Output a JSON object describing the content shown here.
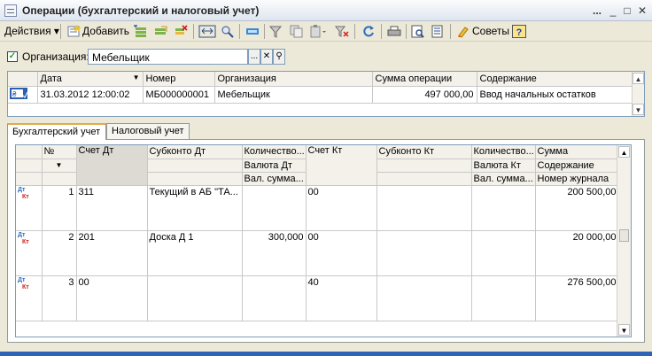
{
  "window": {
    "title": "Операции (бухгалтерский и налоговый учет)",
    "btn_more": "...",
    "btn_min": "_",
    "btn_max": "□",
    "btn_close": "✕"
  },
  "toolbar": {
    "actions_label": "Действия ▾",
    "add_label": "Добавить",
    "tips_label": "Советы"
  },
  "filter": {
    "checkbox_mark": "✓",
    "label": "Организация:",
    "value": "Мебельщик",
    "btn_select": "...",
    "btn_clear": "✕",
    "btn_open": "⚲"
  },
  "operations": {
    "columns": [
      "Дата",
      "Номер",
      "Организация",
      "Сумма операции",
      "Содержание"
    ],
    "rows": [
      {
        "date": "31.03.2012 12:00:02",
        "number": "МБ000000001",
        "org": "Мебельщик",
        "sum": "497 000,00",
        "content": "Ввод начальных остатков"
      }
    ]
  },
  "tabs": [
    "Бухгалтерский учет",
    "Налоговый учет"
  ],
  "entries": {
    "headers": {
      "num": "№",
      "acc_dt": "Счет Дт",
      "subkonto_dt": "Субконто Дт",
      "qty_dt": "Количество...",
      "cur_dt": "Валюта Дт",
      "val_sum_dt": "Вал. сумма...",
      "acc_kt": "Счет Кт",
      "subkonto_kt": "Субконто Кт",
      "qty_kt": "Количество...",
      "cur_kt": "Валюта Кт",
      "val_sum_kt": "Вал. сумма...",
      "sum": "Сумма",
      "content": "Содержание",
      "journal_num": "Номер журнала"
    },
    "dt_label": "Дт",
    "kt_label": "Кт",
    "rows": [
      {
        "n": "1",
        "acc_dt": "311",
        "sub_dt": "Текущий в АБ \"ТА...",
        "qty_dt": "",
        "acc_kt": "00",
        "sum": "200 500,00"
      },
      {
        "n": "2",
        "acc_dt": "201",
        "sub_dt": "Доска Д 1",
        "qty_dt": "300,000",
        "acc_kt": "00",
        "sum": "20 000,00"
      },
      {
        "n": "3",
        "acc_dt": "00",
        "sub_dt": "",
        "qty_dt": "",
        "acc_kt": "40",
        "sum": "276 500,00"
      }
    ]
  }
}
